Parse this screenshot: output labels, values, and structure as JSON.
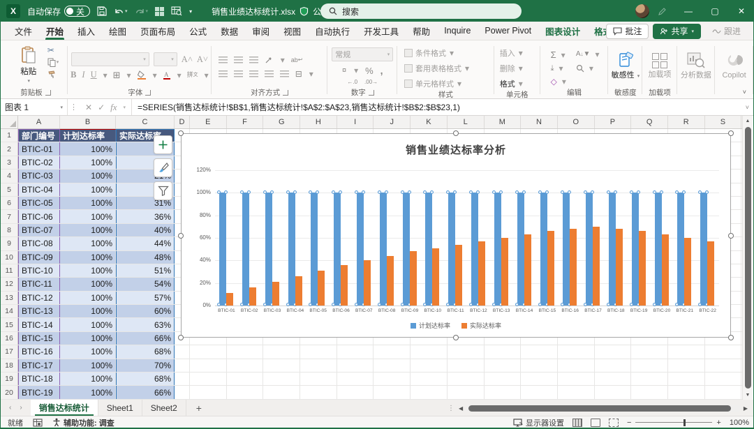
{
  "window": {
    "autosave_label": "自动保存",
    "autosave_state": "关",
    "filename": "销售业绩达标统计.xlsx",
    "doc_badge": "公开文档",
    "search_placeholder": "搜索"
  },
  "menu": {
    "tabs": [
      {
        "label": "文件"
      },
      {
        "label": "开始",
        "active": true
      },
      {
        "label": "插入"
      },
      {
        "label": "绘图"
      },
      {
        "label": "页面布局"
      },
      {
        "label": "公式"
      },
      {
        "label": "数据"
      },
      {
        "label": "审阅"
      },
      {
        "label": "视图"
      },
      {
        "label": "自动执行"
      },
      {
        "label": "开发工具"
      },
      {
        "label": "帮助"
      },
      {
        "label": "Inquire"
      },
      {
        "label": "Power Pivot"
      },
      {
        "label": "图表设计",
        "contextual": true
      },
      {
        "label": "格式",
        "contextual": true
      }
    ],
    "right": {
      "comments": "批注",
      "share": "共享",
      "follow": "跟进"
    }
  },
  "ribbon": {
    "paste_label": "粘贴",
    "clipboard_group": "剪贴板",
    "font_group": "字体",
    "align_group": "对齐方式",
    "number_group": "数字",
    "number_format": "常规",
    "style_items": [
      "条件格式",
      "套用表格格式",
      "单元格样式"
    ],
    "style_group": "样式",
    "cell_items": [
      "插入",
      "删除",
      "格式"
    ],
    "cells_group": "单元格",
    "editing_group": "编辑",
    "sensitivity_label": "敏感性",
    "sensitivity_group": "敏感度",
    "addins_label": "加载项",
    "addins_group": "加载项",
    "analyze_label": "分析数据",
    "copilot_label": "Copilot"
  },
  "formula_bar": {
    "name_box": "图表 1",
    "formula": "=SERIES(销售达标统计!$B$1,销售达标统计!$A$2:$A$23,销售达标统计!$B$2:$B$23,1)"
  },
  "grid": {
    "column_letters": [
      "A",
      "B",
      "C",
      "D",
      "E",
      "F",
      "G",
      "H",
      "I",
      "J",
      "K",
      "L",
      "M",
      "N",
      "O",
      "P",
      "Q",
      "R",
      "S"
    ],
    "row_count": 20,
    "table": {
      "headers": [
        "部门编号",
        "计划达标率",
        "实际达标率"
      ],
      "rows": [
        [
          "BTIC-01",
          "100%",
          "11%"
        ],
        [
          "BTIC-02",
          "100%",
          "16%"
        ],
        [
          "BTIC-03",
          "100%",
          "21%"
        ],
        [
          "BTIC-04",
          "100%",
          "26%"
        ],
        [
          "BTIC-05",
          "100%",
          "31%"
        ],
        [
          "BTIC-06",
          "100%",
          "36%"
        ],
        [
          "BTIC-07",
          "100%",
          "40%"
        ],
        [
          "BTIC-08",
          "100%",
          "44%"
        ],
        [
          "BTIC-09",
          "100%",
          "48%"
        ],
        [
          "BTIC-10",
          "100%",
          "51%"
        ],
        [
          "BTIC-11",
          "100%",
          "54%"
        ],
        [
          "BTIC-12",
          "100%",
          "57%"
        ],
        [
          "BTIC-13",
          "100%",
          "60%"
        ],
        [
          "BTIC-14",
          "100%",
          "63%"
        ],
        [
          "BTIC-15",
          "100%",
          "66%"
        ],
        [
          "BTIC-16",
          "100%",
          "68%"
        ],
        [
          "BTIC-17",
          "100%",
          "70%"
        ],
        [
          "BTIC-18",
          "100%",
          "68%"
        ],
        [
          "BTIC-19",
          "100%",
          "66%"
        ]
      ]
    }
  },
  "chart_data": {
    "type": "bar",
    "title": "销售业绩达标率分析",
    "categories": [
      "BTIC-01",
      "BTIC-02",
      "BTIC-03",
      "BTIC-04",
      "BTIC-05",
      "BTIC-06",
      "BTIC-07",
      "BTIC-08",
      "BTIC-09",
      "BTIC-10",
      "BTIC-11",
      "BTIC-12",
      "BTIC-13",
      "BTIC-14",
      "BTIC-15",
      "BTIC-16",
      "BTIC-17",
      "BTIC-18",
      "BTIC-19",
      "BTIC-20",
      "BTIC-21",
      "BTIC-22"
    ],
    "series": [
      {
        "name": "计划达标率",
        "color": "#5B9BD5",
        "selected": true,
        "values": [
          100,
          100,
          100,
          100,
          100,
          100,
          100,
          100,
          100,
          100,
          100,
          100,
          100,
          100,
          100,
          100,
          100,
          100,
          100,
          100,
          100,
          100
        ]
      },
      {
        "name": "实际达标率",
        "color": "#ED7D31",
        "selected": false,
        "values": [
          11,
          16,
          21,
          26,
          31,
          36,
          40,
          44,
          48,
          51,
          54,
          57,
          60,
          63,
          66,
          68,
          70,
          68,
          66,
          63,
          60,
          57
        ]
      }
    ],
    "y_ticks": [
      "0%",
      "20%",
      "40%",
      "60%",
      "80%",
      "100%",
      "120%"
    ],
    "ylim": [
      0,
      120
    ],
    "grid": true,
    "legend_position": "bottom"
  },
  "chart_buttons": [
    "plus-icon",
    "brush-icon",
    "funnel-icon"
  ],
  "sheet_tabs": {
    "tabs": [
      {
        "label": "销售达标统计",
        "active": true
      },
      {
        "label": "Sheet1"
      },
      {
        "label": "Sheet2"
      }
    ]
  },
  "status_bar": {
    "ready": "就绪",
    "accessibility": "辅助功能: 调查",
    "display_settings": "显示器设置",
    "zoom": "100%"
  }
}
